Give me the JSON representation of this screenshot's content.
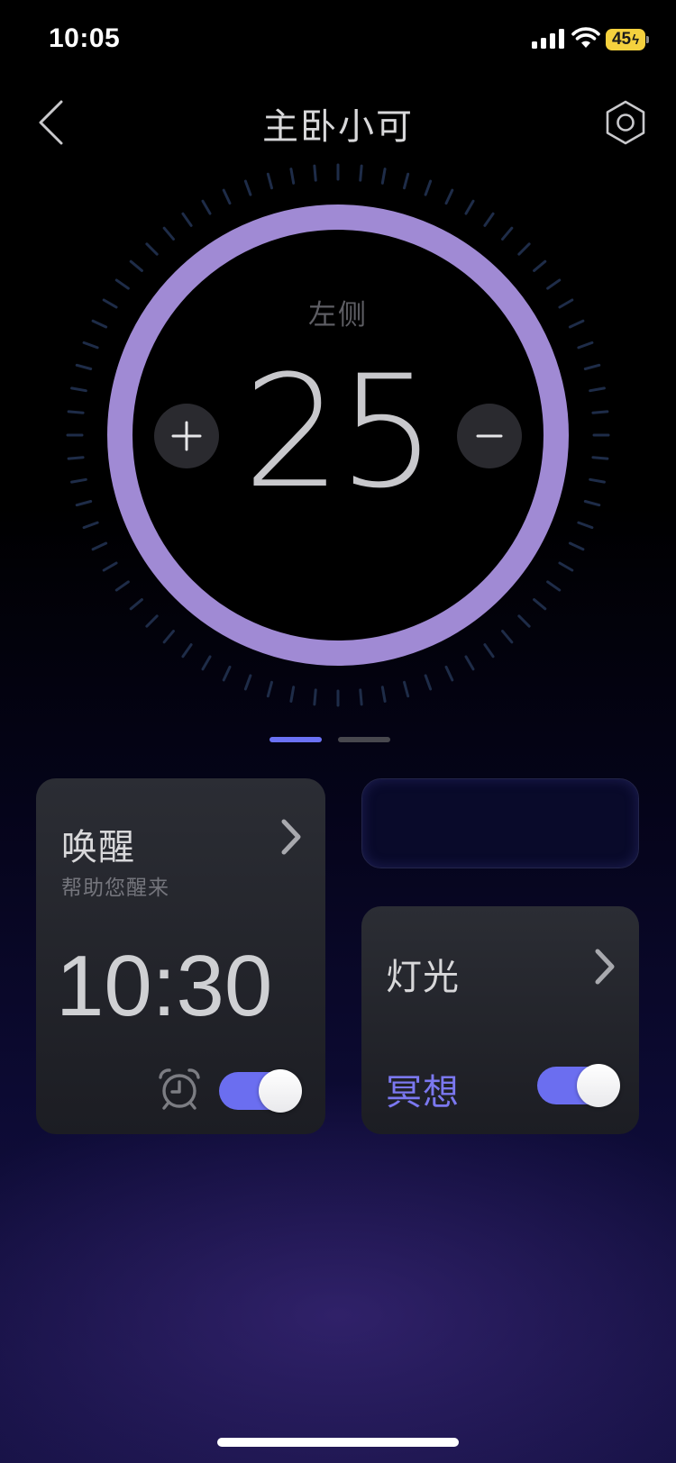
{
  "status_bar": {
    "time": "10:05",
    "battery": "45",
    "icons": [
      "signal-icon",
      "wifi-icon",
      "battery-icon"
    ]
  },
  "header": {
    "title": "主卧小可",
    "back_icon": "chevron-left-icon",
    "settings_icon": "hexagon-settings-icon"
  },
  "dial": {
    "side_label": "左侧",
    "value": "25",
    "plus_icon": "plus-icon",
    "minus_icon": "minus-icon",
    "ring_color": "#a08ad4",
    "tick_color": "#1e2c48"
  },
  "pager": {
    "page_count": 2,
    "active_page": 1,
    "active_color": "#6b72f5",
    "inactive_color": "#48484e"
  },
  "wake_card": {
    "title": "唤醒",
    "subtitle": "帮助您醒来",
    "time": "10:30",
    "alarm_icon": "alarm-clock-icon",
    "arrow_icon": "chevron-right-icon",
    "toggle_on": true
  },
  "light_card": {
    "title": "灯光",
    "mode": "冥想",
    "arrow_icon": "chevron-right-icon",
    "toggle_on": true
  },
  "colors": {
    "accent": "#6b6ef0",
    "mode_text": "#7b78f0"
  }
}
